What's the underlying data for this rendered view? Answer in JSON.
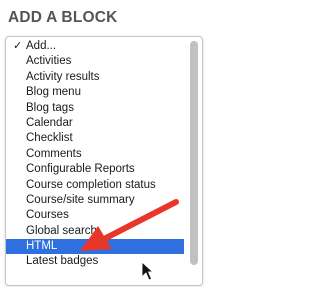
{
  "block": {
    "title": "ADD A BLOCK"
  },
  "select": {
    "selected_option": "Add...",
    "highlighted_option": "HTML",
    "options": [
      {
        "label": "Add..."
      },
      {
        "label": "Activities"
      },
      {
        "label": "Activity results"
      },
      {
        "label": "Blog menu"
      },
      {
        "label": "Blog tags"
      },
      {
        "label": "Calendar"
      },
      {
        "label": "Checklist"
      },
      {
        "label": "Comments"
      },
      {
        "label": "Configurable Reports"
      },
      {
        "label": "Course completion status"
      },
      {
        "label": "Course/site summary"
      },
      {
        "label": "Courses"
      },
      {
        "label": "Global search"
      },
      {
        "label": "HTML"
      },
      {
        "label": "Latest badges"
      }
    ],
    "check_icon": "checkmark-icon"
  },
  "overlay": {
    "arrow_icon": "red-arrow-icon",
    "cursor_icon": "mouse-pointer-icon",
    "arrow_color": "#e8372a",
    "highlight_color": "#2f6fe0"
  }
}
